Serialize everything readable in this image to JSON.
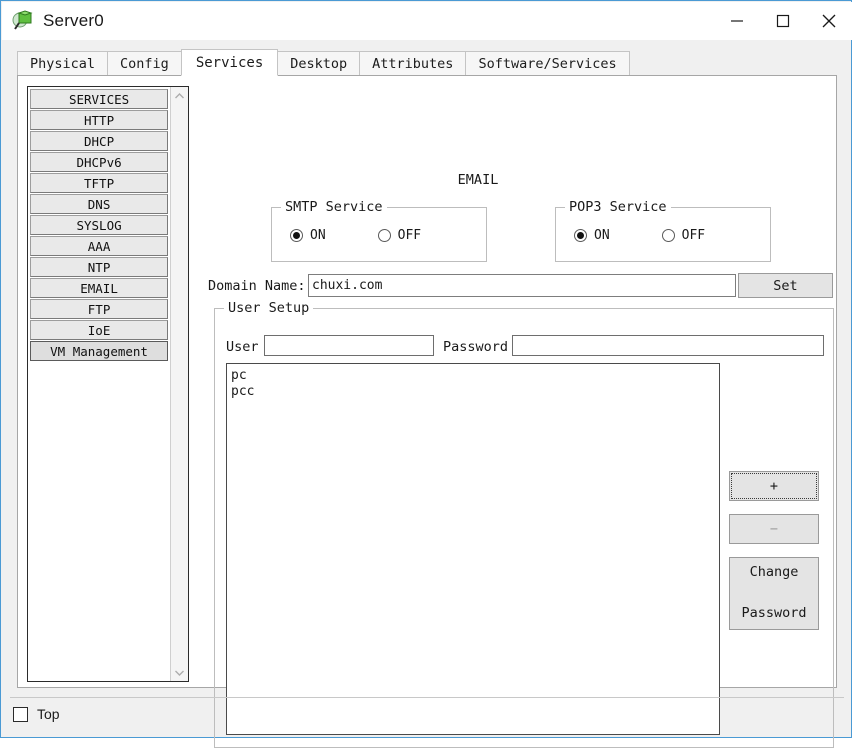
{
  "window": {
    "title": "Server0",
    "icon": "server-device-icon",
    "controls": {
      "minimize": "minimize-icon",
      "maximize": "maximize-icon",
      "close": "close-icon"
    }
  },
  "tabs": [
    {
      "label": "Physical",
      "active": false
    },
    {
      "label": "Config",
      "active": false
    },
    {
      "label": "Services",
      "active": true
    },
    {
      "label": "Desktop",
      "active": false
    },
    {
      "label": "Attributes",
      "active": false
    },
    {
      "label": "Software/Services",
      "active": false
    }
  ],
  "sidebar": {
    "items": [
      {
        "label": "SERVICES",
        "selected": false
      },
      {
        "label": "HTTP",
        "selected": false
      },
      {
        "label": "DHCP",
        "selected": false
      },
      {
        "label": "DHCPv6",
        "selected": false
      },
      {
        "label": "TFTP",
        "selected": false
      },
      {
        "label": "DNS",
        "selected": false
      },
      {
        "label": "SYSLOG",
        "selected": false
      },
      {
        "label": "AAA",
        "selected": false
      },
      {
        "label": "NTP",
        "selected": false
      },
      {
        "label": "EMAIL",
        "selected": false
      },
      {
        "label": "FTP",
        "selected": false
      },
      {
        "label": "IoE",
        "selected": false
      },
      {
        "label": "VM Management",
        "selected": true
      }
    ],
    "scroll_up": "chevron-up-icon",
    "scroll_down": "chevron-down-icon"
  },
  "main": {
    "heading": "EMAIL",
    "smtp": {
      "legend": "SMTP Service",
      "options": [
        {
          "label": "ON",
          "selected": true
        },
        {
          "label": "OFF",
          "selected": false
        }
      ]
    },
    "pop3": {
      "legend": "POP3 Service",
      "options": [
        {
          "label": "ON",
          "selected": true
        },
        {
          "label": "OFF",
          "selected": false
        }
      ]
    },
    "domain": {
      "label": "Domain Name:",
      "value": "chuxi.com",
      "placeholder": "",
      "set_button": "Set"
    },
    "user_setup": {
      "legend": "User Setup",
      "user_label": "User",
      "user_value": "",
      "user_placeholder": "",
      "password_label": "Password",
      "password_value": "",
      "password_placeholder": "",
      "users": [
        "pc",
        "pcc"
      ],
      "add_button": "+",
      "remove_button": "−",
      "change_password_line1": "Change",
      "change_password_line2": "Password"
    }
  },
  "footer": {
    "top_checkbox_label": "Top",
    "top_checked": false
  },
  "colors": {
    "window_border": "#4a9ad4",
    "panel_bg": "#ffffff",
    "button_face": "#e4e4e4",
    "selected_item": "#dedede"
  }
}
